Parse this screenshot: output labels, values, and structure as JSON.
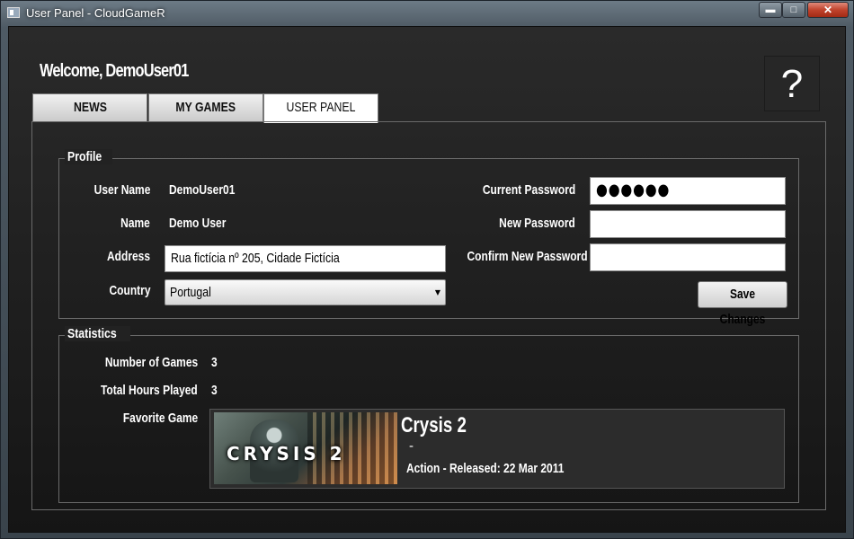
{
  "window": {
    "title": "User Panel - CloudGameR",
    "controls": {
      "minimize": "▬",
      "maximize": "□",
      "close": "✕"
    }
  },
  "header": {
    "welcome": "Welcome, DemoUser01",
    "help_label": "?"
  },
  "tabs": [
    {
      "label": "NEWS",
      "selected": false
    },
    {
      "label": "MY GAMES",
      "selected": false
    },
    {
      "label": "USER PANEL",
      "selected": true
    }
  ],
  "profile": {
    "legend": "Profile",
    "username_label": "User Name",
    "username_value": "DemoUser01",
    "name_label": "Name",
    "name_value": "Demo User",
    "address_label": "Address",
    "address_value": "Rua fictícia nº 205, Cidade Fictícia",
    "country_label": "Country",
    "country_value": "Portugal",
    "current_password_label": "Current Password",
    "current_password_value": "●●●●●●",
    "new_password_label": "New Password",
    "new_password_value": "",
    "confirm_password_label": "Confirm New Password",
    "confirm_password_value": "",
    "save_label": "Save Changes"
  },
  "statistics": {
    "legend": "Statistics",
    "games_label": "Number of Games",
    "games_value": "3",
    "hours_label": "Total Hours Played",
    "hours_value": "3",
    "favorite_label": "Favorite Game",
    "favorite": {
      "title": "Crysis 2",
      "dash": "-",
      "meta": "Action - Released: 22 Mar 2011",
      "thumb_logo": "CRYSIS 2"
    }
  }
}
